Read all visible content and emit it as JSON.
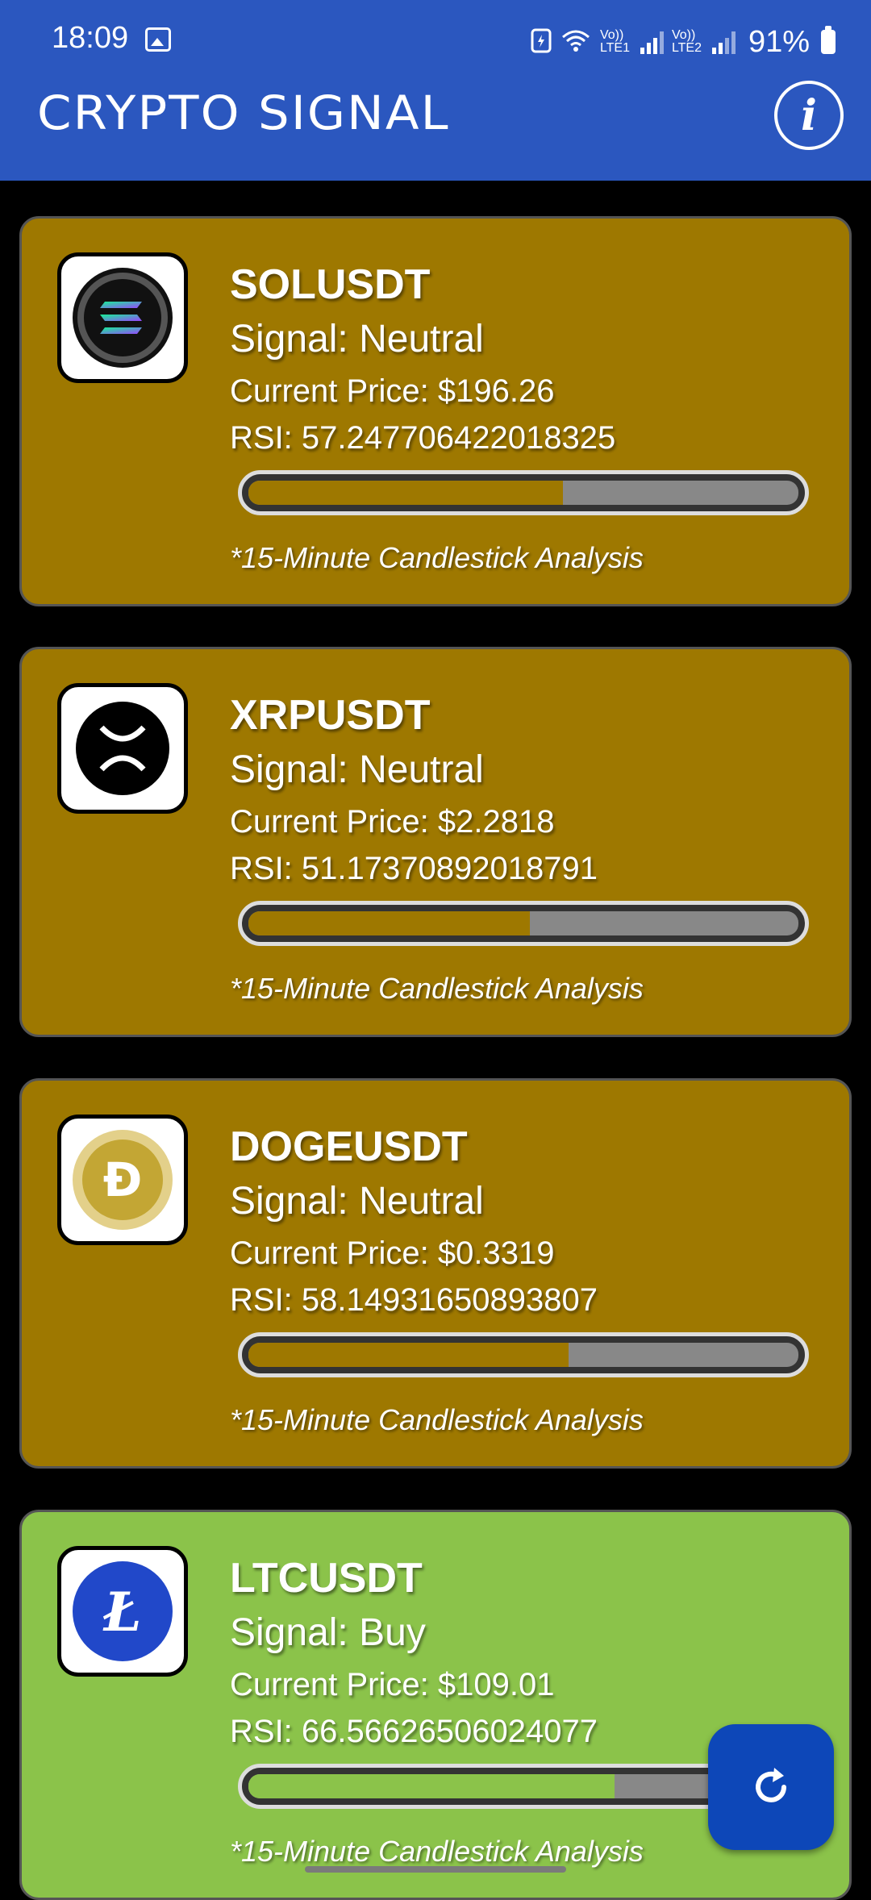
{
  "status_bar": {
    "time": "18:09",
    "network1": "Vo)) LTE1",
    "network2": "Vo)) LTE2",
    "battery": "91%"
  },
  "app_bar": {
    "title": "CRYPTO SIGNAL",
    "info_icon": "info-icon",
    "color": "#2b57bf"
  },
  "colors": {
    "neutral": "#9e7800",
    "buy": "#8bc34a",
    "refresh": "#0d47b8"
  },
  "cards": [
    {
      "symbol": "SOLUSDT",
      "signal": "Signal: Neutral",
      "price": "Current Price: $196.26",
      "rsi": "RSI: 57.247706422018325",
      "rsi_value": 57.25,
      "note": "*15-Minute Candlestick Analysis",
      "icon": "solana-icon"
    },
    {
      "symbol": "XRPUSDT",
      "signal": "Signal: Neutral",
      "price": "Current Price: $2.2818",
      "rsi": "RSI: 51.17370892018791",
      "rsi_value": 51.17,
      "note": "*15-Minute Candlestick Analysis",
      "icon": "xrp-icon"
    },
    {
      "symbol": "DOGEUSDT",
      "signal": "Signal: Neutral",
      "price": "Current Price: $0.3319",
      "rsi": "RSI: 58.14931650893807",
      "rsi_value": 58.15,
      "note": "*15-Minute Candlestick Analysis",
      "icon": "dogecoin-icon"
    },
    {
      "symbol": "LTCUSDT",
      "signal": "Signal: Buy",
      "price": "Current Price: $109.01",
      "rsi": "RSI: 66.56626506024077",
      "rsi_value": 66.57,
      "note": "*15-Minute Candlestick Analysis",
      "icon": "litecoin-icon"
    }
  ],
  "refresh_button": {
    "icon": "refresh-icon"
  }
}
